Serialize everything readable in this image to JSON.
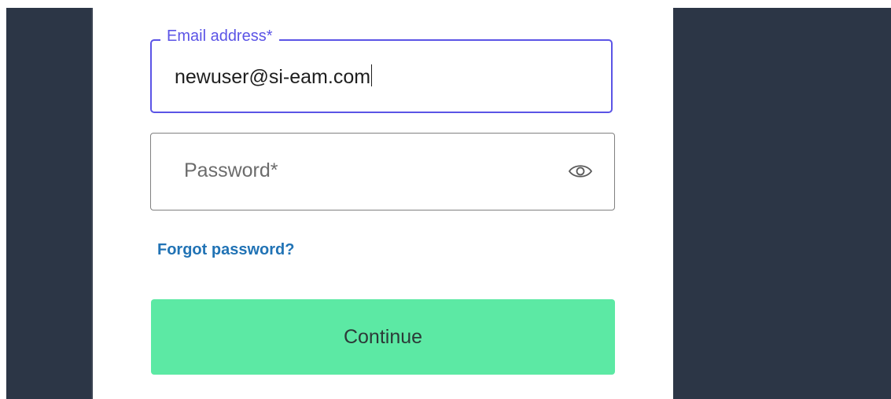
{
  "login_form": {
    "email": {
      "label": "Email address*",
      "value": "newuser@si-eam.com"
    },
    "password": {
      "placeholder": "Password*",
      "toggle_icon": "eye-icon"
    },
    "forgot_password_label": "Forgot password?",
    "continue_label": "Continue"
  },
  "colors": {
    "focus_accent": "#5b54e6",
    "link": "#2173b5",
    "button": "#5ce9a4",
    "side_panel": "#2c3646"
  }
}
